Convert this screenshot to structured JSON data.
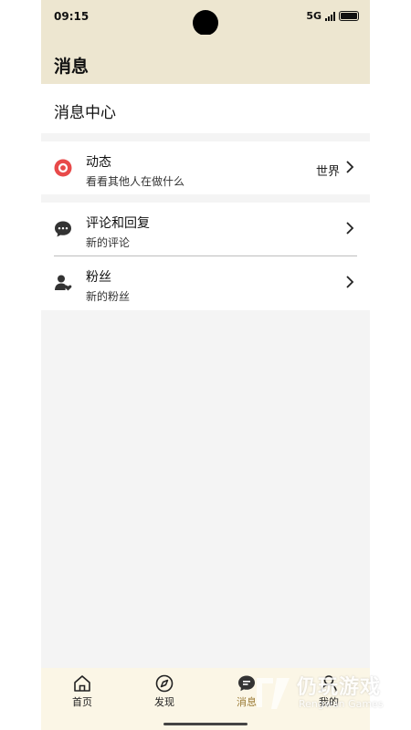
{
  "status": {
    "time": "09:15",
    "network": "5G"
  },
  "header": {
    "title": "消息"
  },
  "section": {
    "title": "消息中心"
  },
  "items": [
    {
      "title": "动态",
      "subtitle": "看看其他人在做什么",
      "right_label": "世界",
      "icon": "target-icon"
    },
    {
      "title": "评论和回复",
      "subtitle": "新的评论",
      "icon": "chat-bubble-icon"
    },
    {
      "title": "粉丝",
      "subtitle": "新的粉丝",
      "icon": "user-heart-icon"
    }
  ],
  "tabs": [
    {
      "label": "首页",
      "icon": "home-icon"
    },
    {
      "label": "发现",
      "icon": "compass-icon"
    },
    {
      "label": "消息",
      "icon": "message-icon",
      "active": true
    },
    {
      "label": "我的",
      "icon": "profile-icon"
    }
  ],
  "watermark": {
    "title": "仍玩游戏",
    "subtitle": "Rengwan Games"
  },
  "colors": {
    "header_bg": "#ede6d0",
    "accent": "#9a7a35",
    "dynamic_icon": "#e84a4a"
  }
}
